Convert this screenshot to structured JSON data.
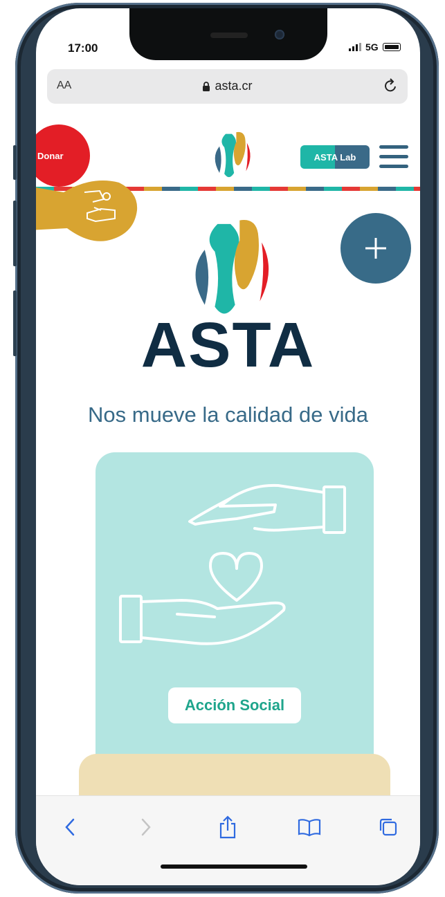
{
  "status_bar": {
    "time": "17:00",
    "network": "5G"
  },
  "browser": {
    "text_size": "AA",
    "url": "asta.cr"
  },
  "site": {
    "donate_label": "Donar",
    "lab_label": "ASTA Lab",
    "brand_name": "ASTA",
    "tagline": "Nos mueve la calidad de vida",
    "card_label": "Acción Social"
  },
  "colors": {
    "teal": "#1fb6a7",
    "red": "#e31e26",
    "gold": "#d8a431",
    "blue": "#386b88",
    "navy": "#102d43",
    "card_bg": "#b3e5e1",
    "card2_bg": "#efdfb5"
  },
  "icons": {
    "url_lock": "lock-icon",
    "url_reload": "reload-icon",
    "hands_coin": "hand-coin-icon",
    "menu": "hamburger-menu-icon",
    "plus": "plus-icon",
    "card_art": "caring-hands-heart-icon",
    "nav": [
      "back-icon",
      "forward-icon",
      "share-icon",
      "bookmarks-icon",
      "tabs-icon"
    ]
  }
}
